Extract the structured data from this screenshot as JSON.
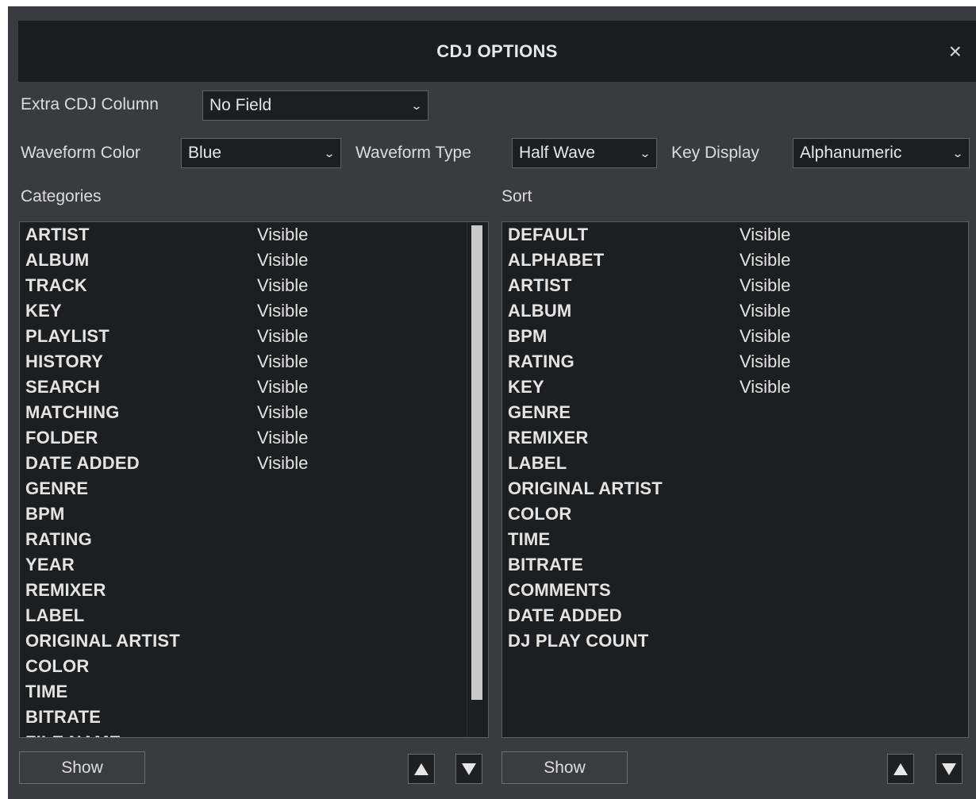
{
  "dialog": {
    "title": "CDJ OPTIONS",
    "close_glyph": "×"
  },
  "extra_column": {
    "label": "Extra CDJ Column",
    "value": "No Field"
  },
  "waveform_color": {
    "label": "Waveform Color",
    "value": "Blue"
  },
  "waveform_type": {
    "label": "Waveform Type",
    "value": "Half Wave"
  },
  "key_display": {
    "label": "Key Display",
    "value": "Alphanumeric"
  },
  "chevron_glyph": "⌄",
  "categories": {
    "header": "Categories",
    "show_label": "Show",
    "items": [
      {
        "name": "ARTIST",
        "status": "Visible"
      },
      {
        "name": "ALBUM",
        "status": "Visible"
      },
      {
        "name": "TRACK",
        "status": "Visible"
      },
      {
        "name": "KEY",
        "status": "Visible"
      },
      {
        "name": "PLAYLIST",
        "status": "Visible"
      },
      {
        "name": "HISTORY",
        "status": "Visible"
      },
      {
        "name": "SEARCH",
        "status": "Visible"
      },
      {
        "name": "MATCHING",
        "status": "Visible"
      },
      {
        "name": "FOLDER",
        "status": "Visible"
      },
      {
        "name": "DATE ADDED",
        "status": "Visible"
      },
      {
        "name": "GENRE",
        "status": ""
      },
      {
        "name": "BPM",
        "status": ""
      },
      {
        "name": "RATING",
        "status": ""
      },
      {
        "name": "YEAR",
        "status": ""
      },
      {
        "name": "REMIXER",
        "status": ""
      },
      {
        "name": "LABEL",
        "status": ""
      },
      {
        "name": "ORIGINAL ARTIST",
        "status": ""
      },
      {
        "name": "COLOR",
        "status": ""
      },
      {
        "name": "TIME",
        "status": ""
      },
      {
        "name": "BITRATE",
        "status": ""
      },
      {
        "name": "FILE NAME",
        "status": ""
      }
    ]
  },
  "sort": {
    "header": "Sort",
    "show_label": "Show",
    "items": [
      {
        "name": "DEFAULT",
        "status": "Visible"
      },
      {
        "name": "ALPHABET",
        "status": "Visible"
      },
      {
        "name": "ARTIST",
        "status": "Visible"
      },
      {
        "name": "ALBUM",
        "status": "Visible"
      },
      {
        "name": "BPM",
        "status": "Visible"
      },
      {
        "name": "RATING",
        "status": "Visible"
      },
      {
        "name": "KEY",
        "status": "Visible"
      },
      {
        "name": "GENRE",
        "status": ""
      },
      {
        "name": "REMIXER",
        "status": ""
      },
      {
        "name": "LABEL",
        "status": ""
      },
      {
        "name": "ORIGINAL ARTIST",
        "status": ""
      },
      {
        "name": "COLOR",
        "status": ""
      },
      {
        "name": "TIME",
        "status": ""
      },
      {
        "name": "BITRATE",
        "status": ""
      },
      {
        "name": "COMMENTS",
        "status": ""
      },
      {
        "name": "DATE ADDED",
        "status": ""
      },
      {
        "name": "DJ PLAY COUNT",
        "status": ""
      }
    ]
  }
}
